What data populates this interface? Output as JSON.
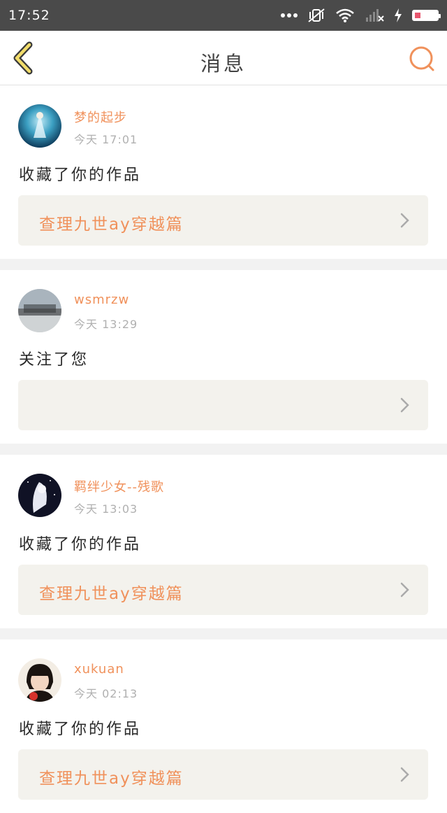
{
  "status_bar": {
    "time": "17:52"
  },
  "nav": {
    "title": "消息"
  },
  "messages": [
    {
      "username": "梦的起步",
      "time": "今天 17:01",
      "action": "收藏了你的作品",
      "work_title": "查理九世ay穿越篇"
    },
    {
      "username": "wsmrzw",
      "time": "今天 13:29",
      "action": "关注了您",
      "work_title": ""
    },
    {
      "username": "羁绊少女--残歌",
      "time": "今天 13:03",
      "action": "收藏了你的作品",
      "work_title": "查理九世ay穿越篇"
    },
    {
      "username": "xukuan",
      "time": "今天 02:13",
      "action": "收藏了你的作品",
      "work_title": "查理九世ay穿越篇"
    }
  ],
  "colors": {
    "accent": "#f0915b",
    "status_bar": "#4a4a4a",
    "card_link_bg": "#f3f2ed",
    "battery": "#e8576f"
  }
}
